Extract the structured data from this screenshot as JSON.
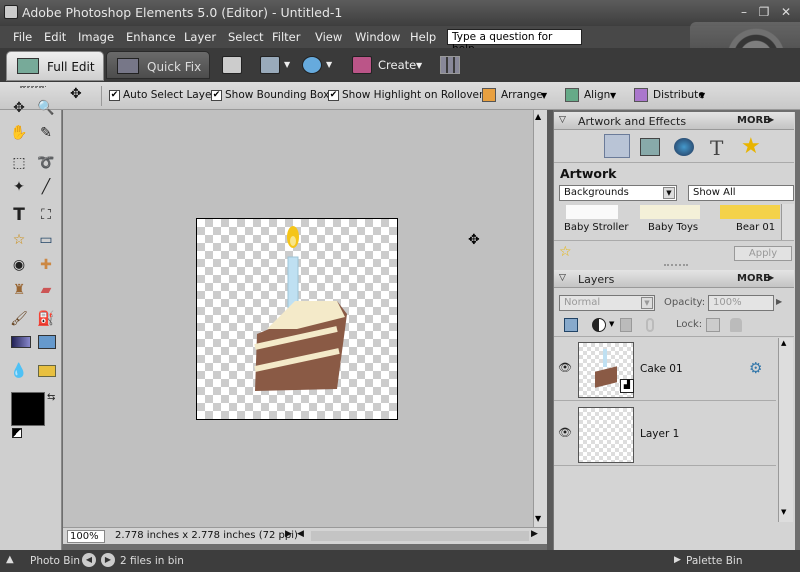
{
  "window": {
    "title": "Adobe Photoshop Elements 5.0 (Editor) - Untitled-1"
  },
  "menu": [
    "File",
    "Edit",
    "Image",
    "Enhance",
    "Layer",
    "Select",
    "Filter",
    "View",
    "Window",
    "Help"
  ],
  "help_search": {
    "value": "Type a question for help"
  },
  "modes": {
    "full_edit": "Full Edit",
    "quick_fix": "Quick Fix",
    "create": "Create"
  },
  "options": {
    "auto_select": {
      "label": "Auto Select Layer",
      "checked": true
    },
    "bounding_box": {
      "label": "Show Bounding Box",
      "checked": true
    },
    "highlight": {
      "label": "Show Highlight on Rollover",
      "checked": true
    },
    "arrange": "Arrange",
    "align": "Align",
    "distribute": "Distribute"
  },
  "status": {
    "zoom": "100%",
    "doc_info": "2.778 inches x 2.778 inches (72 ppi)"
  },
  "bin": {
    "photo_bin": "Photo Bin",
    "files": "2 files in bin",
    "palette_bin": "Palette Bin"
  },
  "artwork_panel": {
    "title": "Artwork and Effects",
    "more": "MORE",
    "section": "Artwork",
    "category": "Backgrounds",
    "filter": "Show All",
    "items": [
      "Baby Stroller",
      "Baby Toys",
      "Bear 01"
    ],
    "apply": "Apply"
  },
  "layers_panel": {
    "title": "Layers",
    "more": "MORE",
    "blend_mode": "Normal",
    "opacity_label": "Opacity:",
    "opacity_value": "100%",
    "lock_label": "Lock:",
    "layers": [
      "Cake 01",
      "Layer 1"
    ]
  },
  "colors": {
    "chrome_dark": "#3d3d3d",
    "panel": "#d4d4d4",
    "canvas_bg": "#c0c0c0",
    "cake_brown": "#8a5a45",
    "cream": "#f4eac9",
    "candle": "#bfe0f2",
    "flame": "#f5c518"
  }
}
